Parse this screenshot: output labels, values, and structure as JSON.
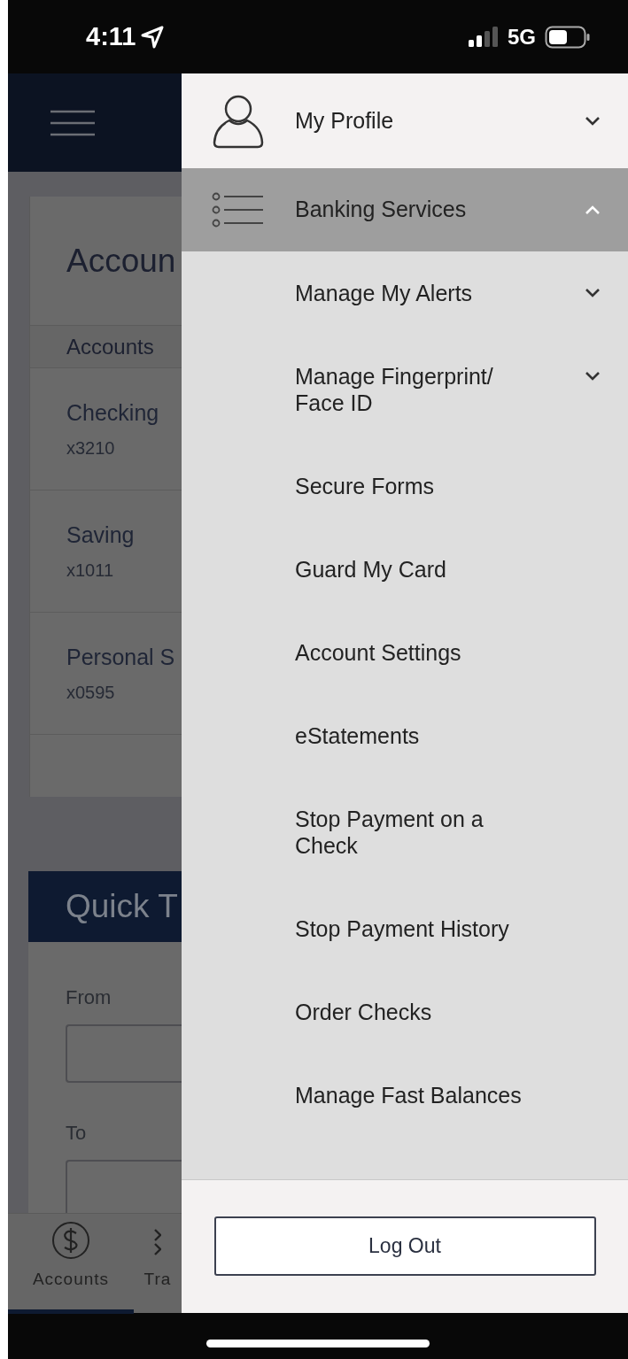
{
  "status_bar": {
    "time": "4:11",
    "network": "5G"
  },
  "background": {
    "title": "Accoun",
    "accounts_header": "Accounts",
    "accounts": [
      {
        "name": "Checking",
        "number": "x3210"
      },
      {
        "name": "Saving",
        "number": "x1011"
      },
      {
        "name": "Personal S",
        "number": "x0595"
      }
    ],
    "quick_transfer": {
      "title": "Quick T",
      "from_label": "From",
      "to_label": "To"
    },
    "tabs": [
      {
        "label": "Accounts",
        "selected": true,
        "kind": "dollar"
      },
      {
        "label": "Tra",
        "selected": false,
        "kind": "transfer"
      }
    ]
  },
  "drawer": {
    "sections": [
      {
        "label": "My Profile",
        "kind": "person",
        "selected": false,
        "expanded": false
      },
      {
        "label": "Banking Services",
        "kind": "list",
        "selected": true,
        "expanded": true
      }
    ],
    "items": [
      {
        "label": "Manage My Alerts",
        "kind": "submenu",
        "expanded": false
      },
      {
        "label": "Manage Fingerprint/\nFace ID",
        "kind": "submenu",
        "expanded": false
      },
      {
        "label": "Secure Forms",
        "kind": "link"
      },
      {
        "label": "Guard My Card",
        "kind": "link"
      },
      {
        "label": "Account Settings",
        "kind": "link"
      },
      {
        "label": "eStatements",
        "kind": "link"
      },
      {
        "label": "Stop Payment on a\nCheck",
        "kind": "link"
      },
      {
        "label": "Stop Payment History",
        "kind": "link"
      },
      {
        "label": "Order Checks",
        "kind": "link"
      },
      {
        "label": "Manage Fast Balances",
        "kind": "link"
      }
    ],
    "logout": "Log Out"
  }
}
